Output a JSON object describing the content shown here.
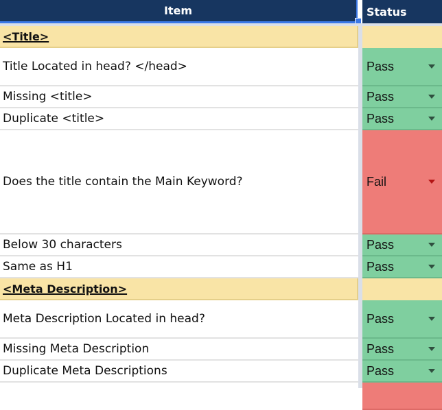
{
  "header": {
    "item_label": "Item",
    "status_label": "Status"
  },
  "rows": [
    {
      "type": "section",
      "item": "<Title>",
      "status": ""
    },
    {
      "type": "check",
      "item": "Title Located in head? </head>",
      "status": "Pass"
    },
    {
      "type": "check",
      "item": "Missing <title>",
      "status": "Pass"
    },
    {
      "type": "check",
      "item": "Duplicate <title>",
      "status": "Pass"
    },
    {
      "type": "check",
      "item": "Does the title contain the Main Keyword?",
      "status": "Fail"
    },
    {
      "type": "check",
      "item": "Below 30 characters",
      "status": "Pass"
    },
    {
      "type": "check",
      "item": "Same as H1",
      "status": "Pass"
    },
    {
      "type": "section",
      "item": "<Meta Description>",
      "status": ""
    },
    {
      "type": "check",
      "item": "Meta Description Located in head?",
      "status": "Pass"
    },
    {
      "type": "check",
      "item": "Missing Meta Description",
      "status": "Pass"
    },
    {
      "type": "check",
      "item": "Duplicate Meta Descriptions",
      "status": "Pass"
    },
    {
      "type": "check",
      "item": "",
      "status": ""
    }
  ],
  "status_colors": {
    "Pass": "#7fcf9f",
    "Fail": "#ee7c78",
    "section": "#f9e4a6",
    "header": "#173660"
  }
}
